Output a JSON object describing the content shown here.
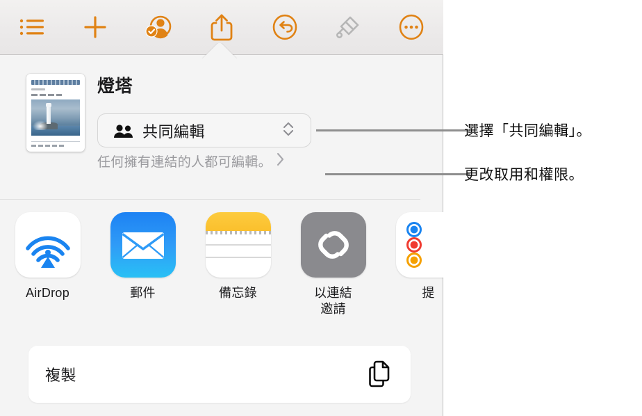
{
  "toolbar": {
    "items": [
      {
        "name": "list-view",
        "icon": "list-bullet-icon",
        "color": "#e08214"
      },
      {
        "name": "insert",
        "icon": "plus-icon",
        "color": "#e08214"
      },
      {
        "name": "collaborate",
        "icon": "person-badge-checkmark-icon",
        "color": "#e08214"
      },
      {
        "name": "share",
        "icon": "share-up-arrow-icon",
        "color": "#e08214"
      },
      {
        "name": "undo",
        "icon": "undo-arrow-circle-icon",
        "color": "#e08214"
      },
      {
        "name": "format-paintbrush",
        "icon": "paintbrush-icon",
        "color": "#b3b3b3"
      },
      {
        "name": "more-options",
        "icon": "ellipsis-circle-icon",
        "color": "#e08214"
      }
    ]
  },
  "share_sheet": {
    "document_title": "燈塔",
    "document_thumbnail_alt": "lighthouse-document-thumbnail",
    "collaboration": {
      "icon": "two-people-icon",
      "selected_option": "共同編輯",
      "chevron_icon": "chevron-up-down-icon"
    },
    "permission": {
      "text": "任何擁有連結的人都可編輯。",
      "chevron_icon": "chevron-right-icon"
    },
    "targets": [
      {
        "label": "AirDrop",
        "icon": "airdrop-icon"
      },
      {
        "label": "郵件",
        "icon": "mail-envelope-icon"
      },
      {
        "label": "備忘錄",
        "icon": "notes-icon"
      },
      {
        "label": "以連結\n邀請",
        "icon": "link-chain-icon"
      },
      {
        "label": "提",
        "icon": "reminders-icon"
      }
    ],
    "copy_action": {
      "label": "複製",
      "icon": "copy-documents-icon"
    }
  },
  "callouts": [
    {
      "text": "選擇「共同編輯」。"
    },
    {
      "text": "更改取用和權限。"
    }
  ]
}
